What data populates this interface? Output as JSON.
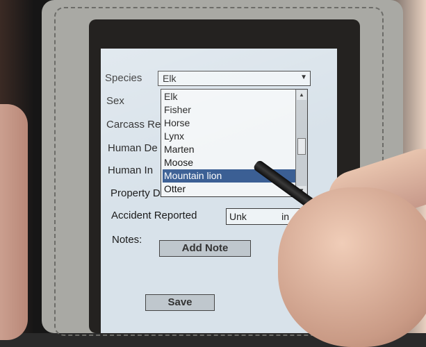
{
  "form": {
    "species_label": "Species",
    "sex_label": "Sex",
    "carcass_label": "Carcass Re",
    "human_de_label": "Human De",
    "human_in_label": "Human In",
    "property_label": "Property D",
    "accident_label": "Accident Reported",
    "notes_label": "Notes:",
    "species_value": "Elk",
    "accident_value": "Unk",
    "accident_value_right": "in",
    "add_note_label": "Add Note",
    "save_label": "Save"
  },
  "dropdown": {
    "options": [
      "Elk",
      "Fisher",
      "Horse",
      "Lynx",
      "Marten",
      "Moose",
      "Mountain lion",
      "Otter"
    ],
    "selected": "Mountain lion"
  },
  "icons": {
    "dropdown_arrow": "▼",
    "scroll_up": "▲",
    "scroll_down": "▼"
  }
}
